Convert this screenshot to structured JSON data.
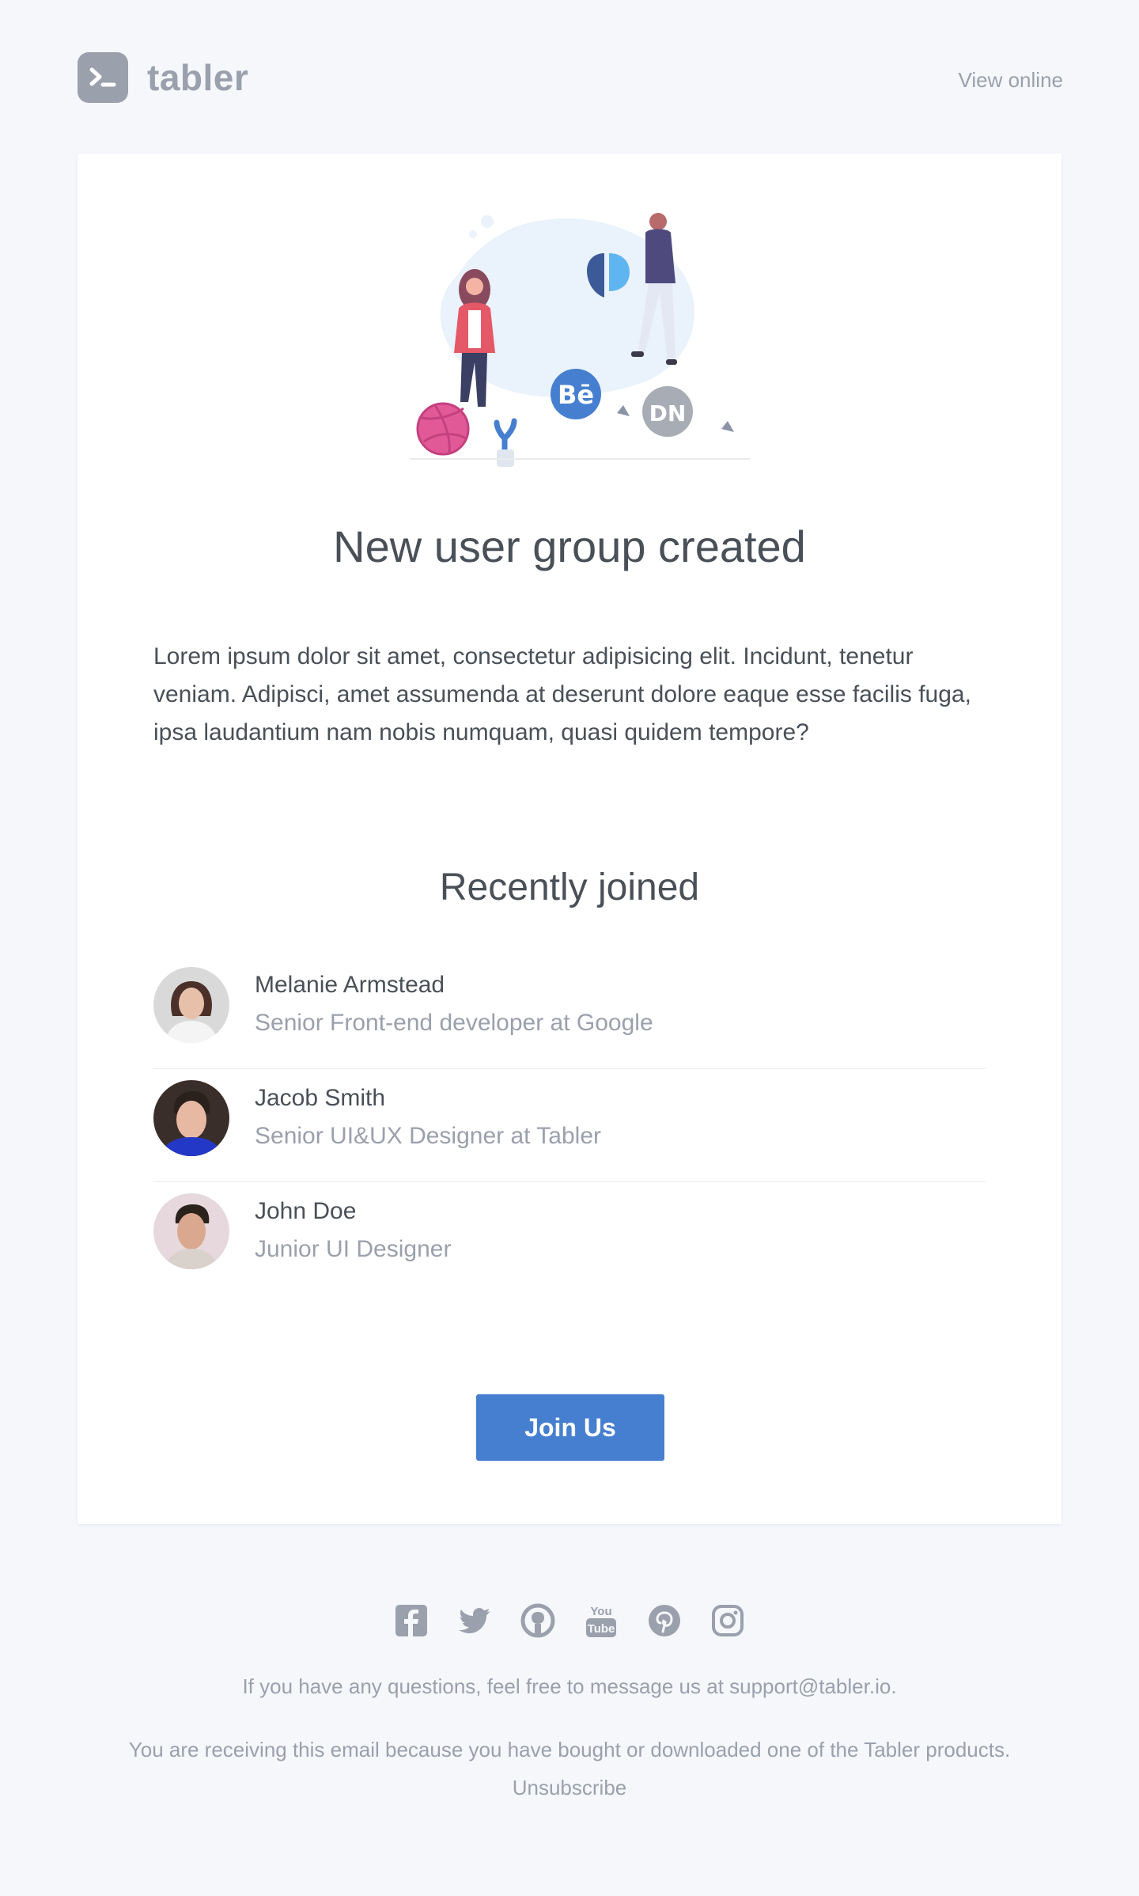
{
  "header": {
    "brand": "tabler",
    "view_online": "View online"
  },
  "email": {
    "title": "New user group created",
    "body": "Lorem ipsum dolor sit amet, consectetur adipisicing elit. Incidunt, tenetur veniam. Adipisci, amet assumenda at deserunt dolore eaque esse facilis fuga, ipsa laudantium nam nobis numquam, quasi quidem tempore?",
    "illustration_badges": [
      "Bē",
      "DN"
    ],
    "recently_joined_title": "Recently joined",
    "members": [
      {
        "name": "Melanie Armstead",
        "role": "Senior Front-end developer at Google"
      },
      {
        "name": "Jacob Smith",
        "role": "Senior UI&UX Designer at Tabler"
      },
      {
        "name": "John Doe",
        "role": "Junior UI Designer"
      }
    ],
    "cta_label": "Join Us"
  },
  "footer": {
    "social_icons": [
      "facebook-icon",
      "twitter-icon",
      "github-icon",
      "youtube-icon",
      "pinterest-icon",
      "instagram-icon"
    ],
    "youtube_glyph": [
      "You",
      "Tube"
    ],
    "questions": "If you have any questions, feel free to message us at support@tabler.io.",
    "reason": "You are receiving this email because you have bought or downloaded one of the Tabler products.",
    "unsubscribe": "Unsubscribe"
  },
  "colors": {
    "background": "#f5f7fb",
    "primary": "#467fcf",
    "muted": "#9aa0ac",
    "text": "#495057"
  }
}
